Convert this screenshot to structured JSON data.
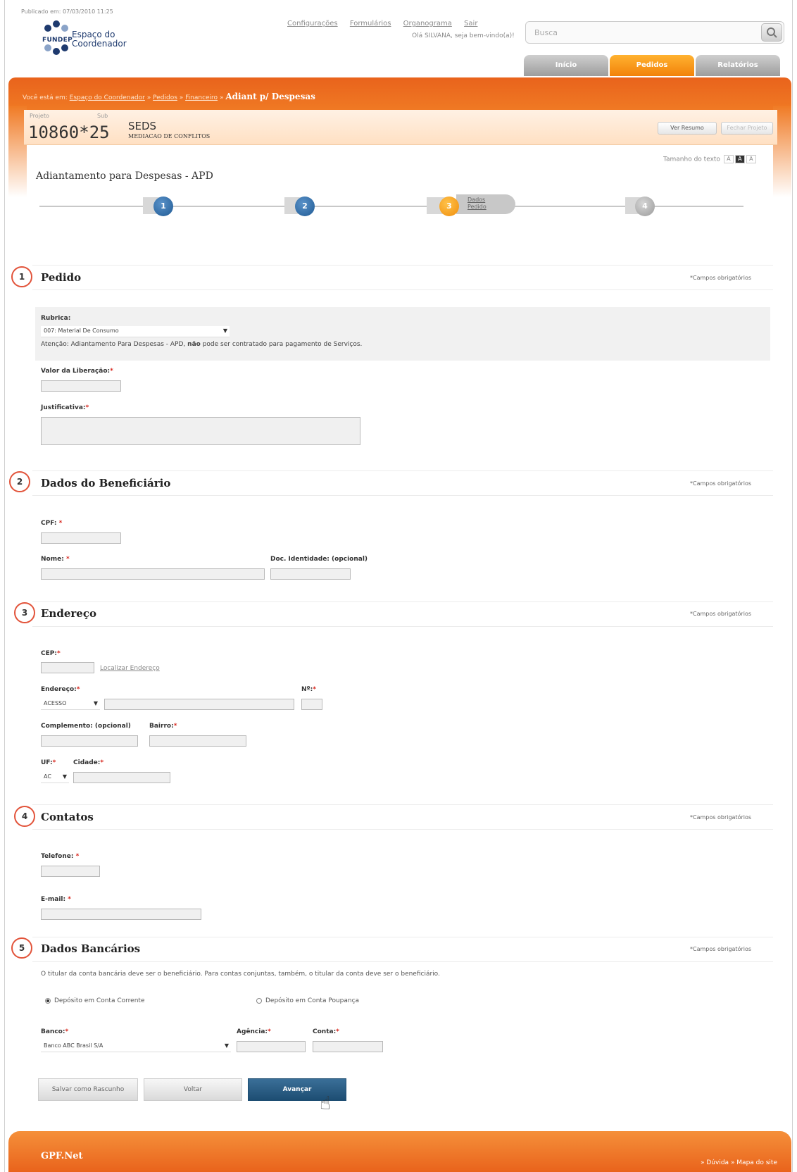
{
  "header": {
    "published": "Publicado em: 07/03/2010 11:25",
    "logo_brand": "FUNDEP",
    "logo_title_1": "Espaço do",
    "logo_title_2": "Coordenador",
    "links": [
      "Configurações",
      "Formulários",
      "Organograma",
      "Sair"
    ],
    "greeting": "Olá SILVANA, seja bem-vindo(a)!",
    "search_placeholder": "Busca",
    "nav": [
      "Início",
      "Pedidos",
      "Relatórios"
    ],
    "accent": "#f07a24",
    "active_tab": "Pedidos"
  },
  "breadcrumb": {
    "prefix": "Você está em:",
    "items": [
      "Espaço do Coordenador",
      "Pedidos",
      "Financeiro"
    ],
    "current": "Adiant p/ Despesas"
  },
  "project": {
    "label_project": "Projeto",
    "label_sub": "Sub",
    "number": "10860*25",
    "sub_code": "SEDS",
    "sub_name": "MEDIACAO DE CONFLITOS",
    "btn_summary": "Ver Resumo",
    "btn_fechar": "Fechar Projeto"
  },
  "page": {
    "text_size_label": "Tamanho do texto",
    "text_size_options": [
      "A",
      "A",
      "A"
    ],
    "title": "Adiantamento para Despesas - APD",
    "steps": [
      "1",
      "2",
      "3",
      "4"
    ],
    "current_step_label_1": "Dados",
    "current_step_label_2": "Pedido"
  },
  "required_note": "*Campos obrigatórios",
  "sections": {
    "pedido": {
      "num": "1",
      "title": "Pedido",
      "rubrica_label": "Rubrica:",
      "rubrica_value": "007: Material De Consumo",
      "warning_prefix": "Atenção: Adiantamento Para Despesas - APD,",
      "warning_bold": "não",
      "warning_suffix": "pode ser contratado para pagamento de Serviços.",
      "valor_label": "Valor da Liberação:",
      "justificativa_label": "Justificativa:"
    },
    "beneficiario": {
      "num": "2",
      "title": "Dados do Beneficiário",
      "cpf_label": "CPF:",
      "nome_label": "Nome:",
      "doc_label": "Doc. Identidade: (opcional)"
    },
    "endereco": {
      "num": "3",
      "title": "Endereço",
      "cep_label": "CEP:",
      "locate_link": "Localizar Endereço",
      "endereco_label": "Endereço:",
      "tipo_value": "ACESSO",
      "numero_label": "Nº:",
      "complemento_label": "Complemento: (opcional)",
      "bairro_label": "Bairro:",
      "uf_label": "UF:",
      "uf_value": "AC",
      "cidade_label": "Cidade:"
    },
    "contatos": {
      "num": "4",
      "title": "Contatos",
      "telefone_label": "Telefone:",
      "email_label": "E-mail:"
    },
    "bancarios": {
      "num": "5",
      "title": "Dados Bancários",
      "note": "O titular da conta bancária deve ser o beneficiário. Para contas conjuntas, também, o titular da conta deve ser o beneficiário.",
      "radio_corrente": "Depósito em Conta Corrente",
      "radio_poupanca": "Depósito em Conta Poupança",
      "banco_label": "Banco:",
      "banco_value": "Banco ABC Brasil S/A",
      "agencia_label": "Agência:",
      "conta_label": "Conta:"
    }
  },
  "buttons": {
    "draft": "Salvar como Rascunho",
    "back": "Voltar",
    "next": "Avançar"
  },
  "footer": {
    "brand": "GPF.Net",
    "links": "» Dúvida  » Mapa do site"
  }
}
